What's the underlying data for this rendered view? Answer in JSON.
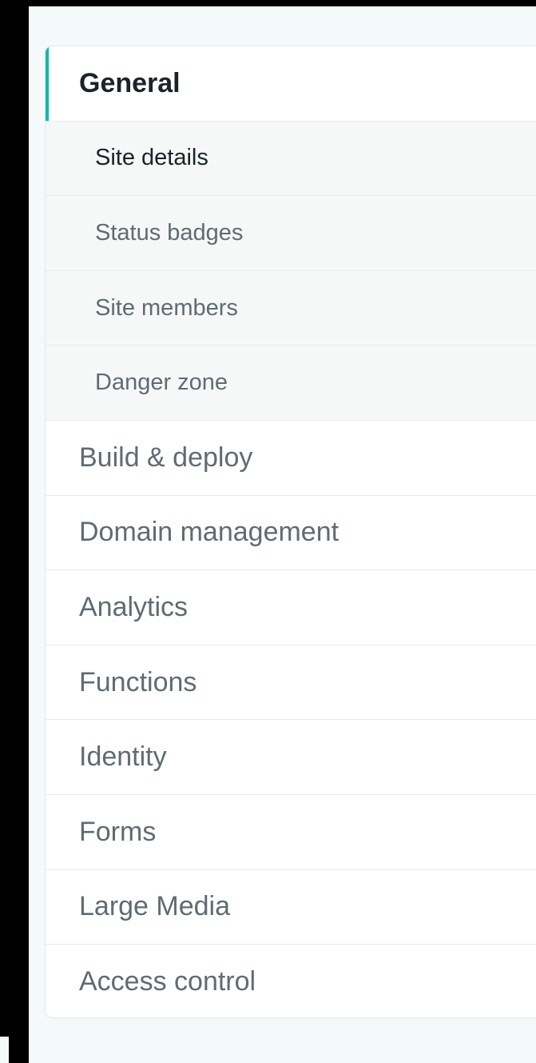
{
  "sidebar": {
    "active_section": "General",
    "accent_color": "#14b8a6",
    "sections": [
      {
        "label": "General",
        "active": true,
        "subitems": [
          {
            "label": "Site details",
            "current": true
          },
          {
            "label": "Status badges"
          },
          {
            "label": "Site members"
          },
          {
            "label": "Danger zone"
          }
        ]
      },
      {
        "label": "Build & deploy"
      },
      {
        "label": "Domain management"
      },
      {
        "label": "Analytics"
      },
      {
        "label": "Functions"
      },
      {
        "label": "Identity"
      },
      {
        "label": "Forms"
      },
      {
        "label": "Large Media"
      },
      {
        "label": "Access control"
      }
    ]
  }
}
